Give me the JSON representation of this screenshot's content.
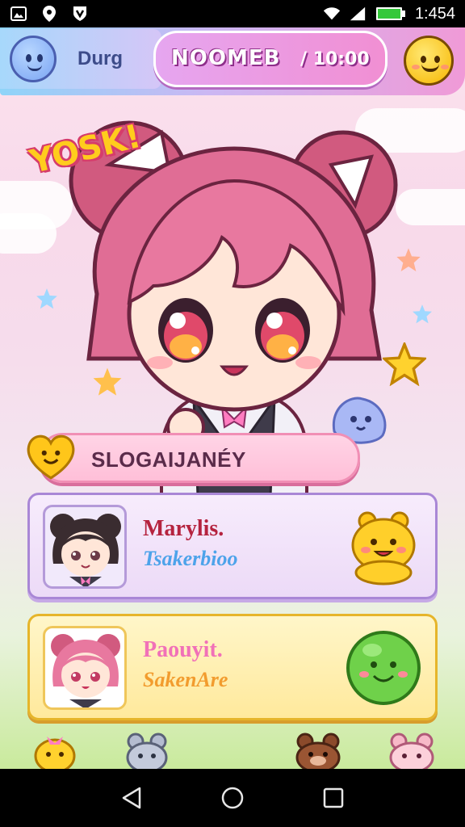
{
  "status_bar": {
    "icons_left": [
      "gallery-icon",
      "location-icon",
      "shield-icon"
    ],
    "icons_right": [
      "wifi-icon",
      "signal-icon",
      "battery-icon"
    ],
    "time": "1:454"
  },
  "header": {
    "username": "Durg",
    "room_title": "NOOMEB",
    "room_time": "/ 10:00",
    "left_avatar_icon": "blue-blob-avatar-icon",
    "right_icon": "smiley-face-icon"
  },
  "sticker_text": "YOSK!",
  "slogan": {
    "text": "SLOGAIJANÉY",
    "icon": "smiley-heart-icon"
  },
  "cards": [
    {
      "name": "Marylis.",
      "subtitle": "Tsakerbioo",
      "avatar_icon": "dark-haired-girl-avatar",
      "mascot_icon": "yellow-bear-mascot-icon"
    },
    {
      "name": "Paouyit.",
      "subtitle": "SakenAre",
      "avatar_icon": "pink-haired-girl-avatar",
      "mascot_icon": "green-blob-mascot-icon"
    }
  ],
  "bottom_mascots": [
    "yellow-chick-icon",
    "grey-mouse-icon",
    "brown-bear-icon",
    "pink-bear-icon"
  ],
  "nav_bar": [
    "back-icon",
    "home-icon",
    "recents-icon"
  ],
  "colors": {
    "header_gradient_start": "#8fd4f8",
    "header_gradient_end": "#f09ad7",
    "card1_border": "#a987d6",
    "card2_border": "#e6b52a",
    "slogan_bg": "#ffbfd8"
  }
}
